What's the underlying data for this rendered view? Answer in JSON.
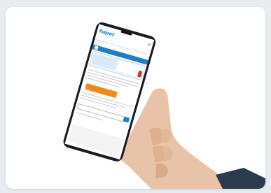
{
  "scene": {
    "subject": "hand-holding-smartphone",
    "background_color": "#ffffff",
    "frame_color": "#e8ecf0"
  },
  "phone_screen": {
    "logo": "hapot",
    "accent_color": "#1f7fc6",
    "button_color": "#ef8a1c",
    "badge_color": "#d0322c"
  }
}
